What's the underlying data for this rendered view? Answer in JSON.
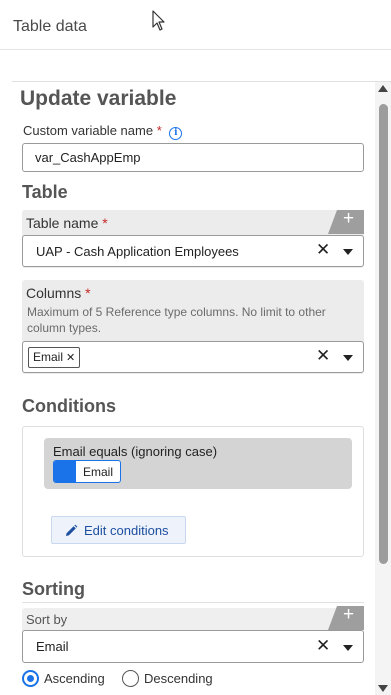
{
  "header": {
    "title": "Table data"
  },
  "form": {
    "heading": "Update variable",
    "variable_name": {
      "label": "Custom variable name",
      "required_mark": "*",
      "value": "var_CashAppEmp"
    },
    "table_section": {
      "heading": "Table",
      "table_name": {
        "label": "Table name",
        "required_mark": "*",
        "value": "UAP - Cash Application Employees",
        "add_label": "+"
      },
      "columns": {
        "label": "Columns",
        "required_mark": "*",
        "help": "Maximum of 5 Reference type columns. No limit to other column types.",
        "chips": [
          "Email"
        ]
      }
    },
    "conditions": {
      "heading": "Conditions",
      "rule_text": "Email equals (ignoring case)",
      "rule_field": "Email",
      "edit_label": "Edit conditions"
    },
    "sorting": {
      "heading": "Sorting",
      "sort_by": {
        "label": "Sort by",
        "value": "Email",
        "add_label": "+"
      },
      "order_options": [
        "Ascending",
        "Descending"
      ],
      "selected_order": "Ascending"
    }
  },
  "icons": {
    "info": "info-icon",
    "clear": "close-icon",
    "dropdown": "chevron-down-icon",
    "edit": "pencil-icon",
    "add": "plus-icon"
  },
  "colors": {
    "accent": "#1a73e8",
    "required": "#c62828"
  }
}
